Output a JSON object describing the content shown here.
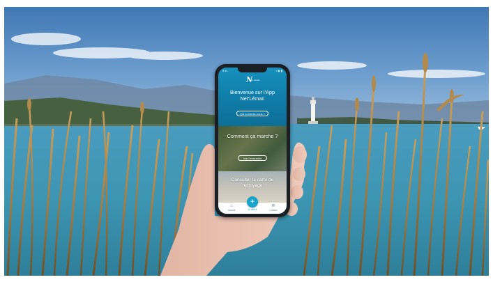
{
  "phone": {
    "status_time": "9:41",
    "status_icons": "▪ ◉ ▮",
    "logo_mark": "N",
    "logo_text": "Léman",
    "welcome_text": "Bienvenue sur l’App Net’Léman",
    "welcome_button": "Qui sommes-nous ?",
    "card1": {
      "title": "Comment ça marche ?",
      "button": "Voir l’ensemble"
    },
    "card2": {
      "title": "Consulter la carte de nettoyage"
    },
    "tabs": {
      "home": {
        "label": "Accueil",
        "icon": "home-icon"
      },
      "center": {
        "label": "Je relève",
        "icon": "plus-icon",
        "glyph": "+"
      },
      "right": {
        "label": "Contact",
        "icon": "mail-icon"
      }
    }
  }
}
